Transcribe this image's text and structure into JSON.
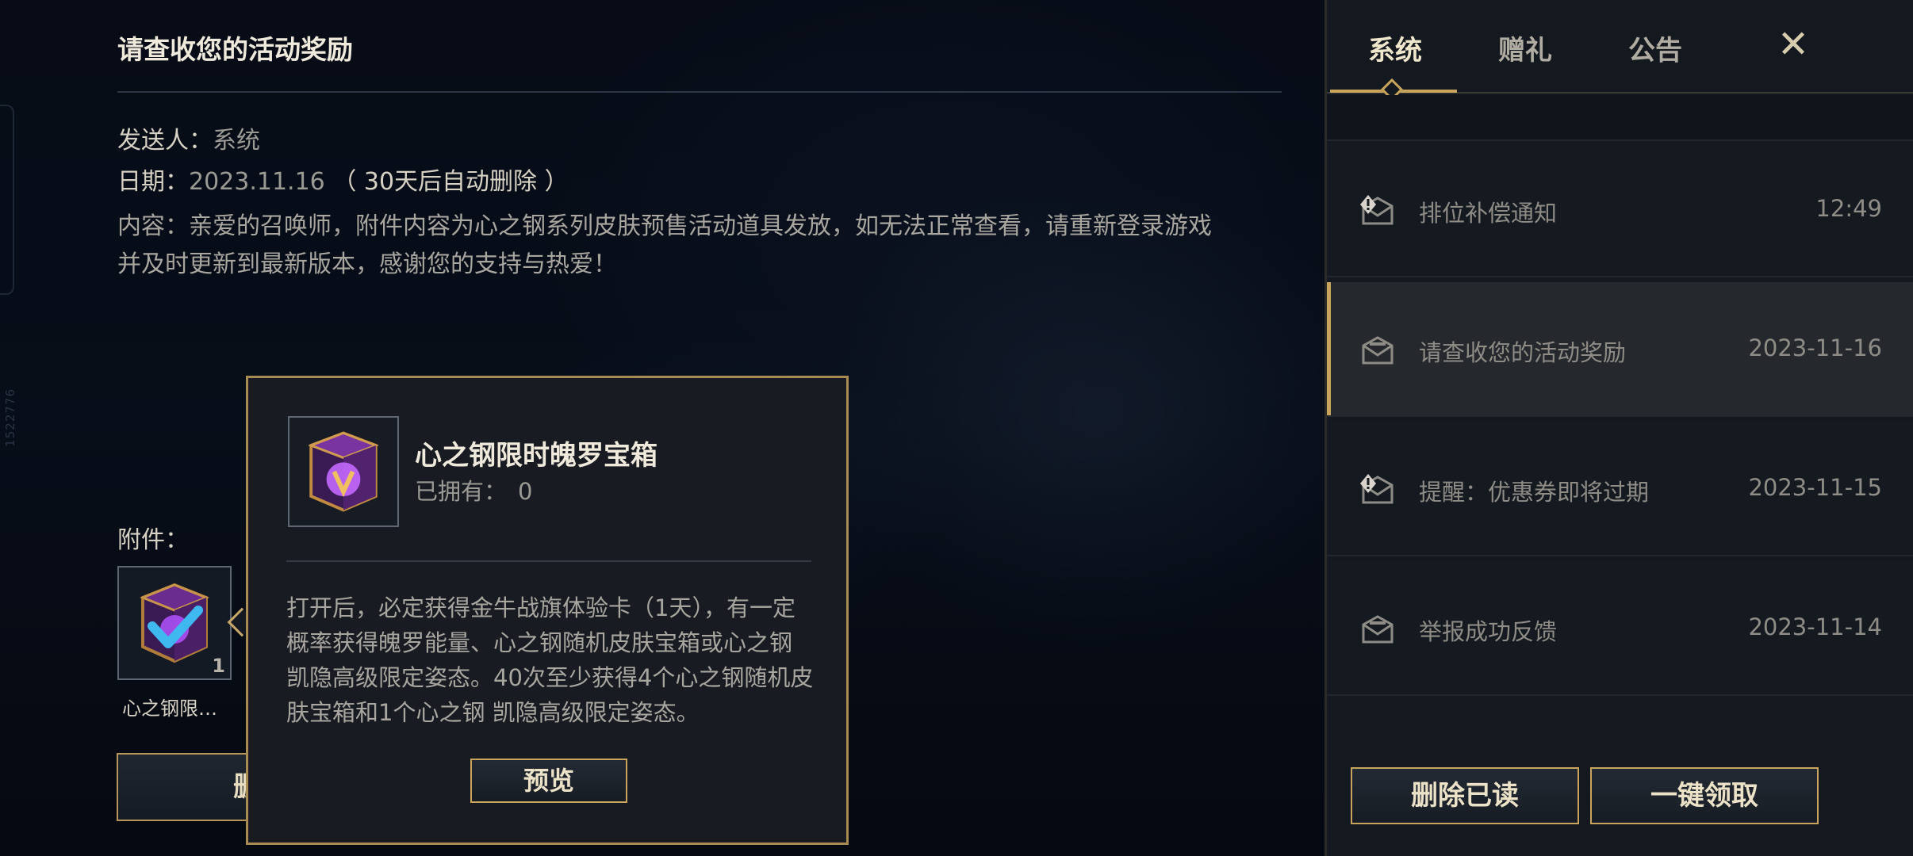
{
  "mail": {
    "title": "请查收您的活动奖励",
    "sender_label": "发送人：",
    "sender_value": "系统",
    "date_label": "日期：",
    "date_value": "2023.11.16",
    "date_note": "（ 30天后自动删除 ）",
    "content_lines": [
      "内容：亲爱的召唤师，附件内容为心之钢系列皮肤预售活动道具发放，如无法正常查看，请重新登录游戏",
      "并及时更新到最新版本，感谢您的支持与热爱！"
    ],
    "attachment_label": "附件：",
    "attachment": {
      "name": "心之钢限…",
      "count": "1"
    },
    "delete_button": "删除"
  },
  "side_code": "1522776",
  "tooltip": {
    "item_name": "心之钢限时魄罗宝箱",
    "owned_label": "已拥有：",
    "owned_value": "0",
    "description_lines": [
      "打开后，必定获得金牛战旗体验卡（1天），有一定",
      "概率获得魄罗能量、心之钢随机皮肤宝箱或心之钢",
      "凯隐高级限定姿态。40次至少获得4个心之钢随机皮",
      "肤宝箱和1个心之钢 凯隐高级限定姿态。"
    ],
    "preview_button": "预览"
  },
  "panel": {
    "tabs": [
      {
        "label": "系统",
        "active": true
      },
      {
        "label": "赠礼",
        "active": false
      },
      {
        "label": "公告",
        "active": false
      }
    ],
    "close_symbol": "✕",
    "mails": [
      {
        "subject": "排位补偿通知",
        "time": "12:49",
        "icon": "mail-alert-icon",
        "selected": false
      },
      {
        "subject": "请查收您的活动奖励",
        "time": "2023-11-16",
        "icon": "mail-read-icon",
        "selected": true
      },
      {
        "subject": "提醒：优惠券即将过期",
        "time": "2023-11-15",
        "icon": "mail-alert-icon",
        "selected": false
      },
      {
        "subject": "举报成功反馈",
        "time": "2023-11-14",
        "icon": "mail-read-icon",
        "selected": false
      }
    ],
    "delete_read_button": "删除已读",
    "claim_all_button": "一键领取"
  },
  "colors": {
    "gold_accent": "#c9a45c",
    "chest_purple": "#9b3fd6",
    "check_blue": "#3fb8f0"
  }
}
